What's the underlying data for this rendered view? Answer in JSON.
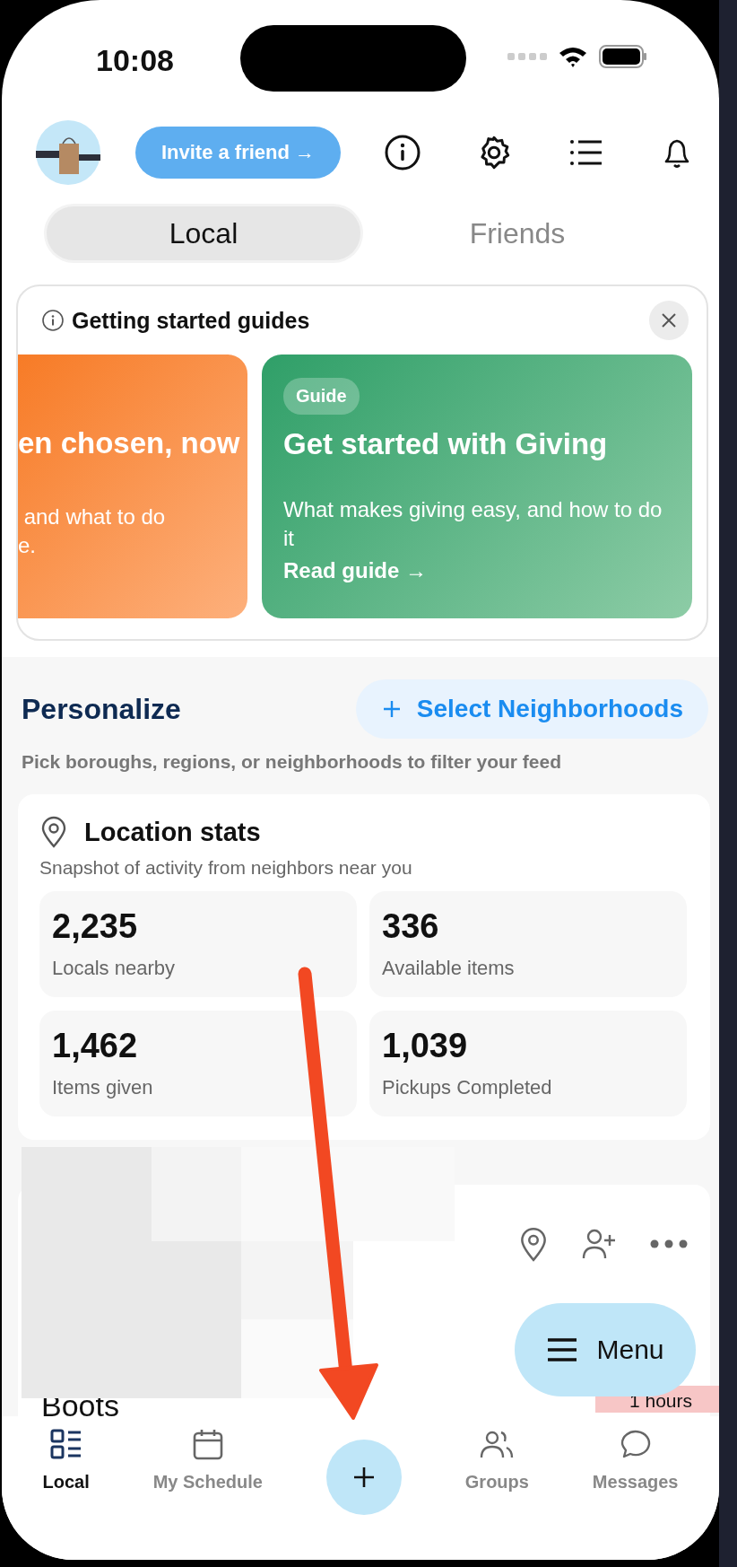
{
  "status_bar": {
    "time": "10:08"
  },
  "header": {
    "invite_button": "Invite a friend →"
  },
  "tabs": [
    {
      "label": "Local",
      "selected": true
    },
    {
      "label": "Friends",
      "selected": false
    }
  ],
  "guides": {
    "title": "Getting started guides",
    "cards": [
      {
        "kind": "orange",
        "title": "en chosen, now",
        "description_lines": [
          " and what to do",
          "e."
        ]
      },
      {
        "kind": "green",
        "badge": "Guide",
        "title": "Get started with Giving",
        "description_lines": [
          "What makes giving easy, and how to do it"
        ],
        "link": "Read guide →"
      }
    ]
  },
  "personalize": {
    "title": "Personalize",
    "button": "Select Neighborhoods",
    "subtitle": "Pick boroughs, regions, or neighborhoods to filter your feed"
  },
  "location_stats": {
    "title": "Location stats",
    "subtitle": "Snapshot of activity from neighbors near you",
    "stats": [
      {
        "value": "2,235",
        "label": "Locals nearby"
      },
      {
        "value": "336",
        "label": "Available items"
      },
      {
        "value": "1,462",
        "label": "Items given"
      },
      {
        "value": "1,039",
        "label": "Pickups Completed"
      }
    ]
  },
  "feed_card": {
    "title": "Boots",
    "badge": "1 hours"
  },
  "menu_button": "Menu",
  "bottom_nav": [
    {
      "kind": "list",
      "label": "Local",
      "selected": true
    },
    {
      "kind": "calendar",
      "label": "My Schedule",
      "selected": false
    },
    {
      "kind": "add"
    },
    {
      "kind": "groups",
      "label": "Groups",
      "selected": false
    },
    {
      "kind": "messages",
      "label": "Messages",
      "selected": false
    }
  ]
}
